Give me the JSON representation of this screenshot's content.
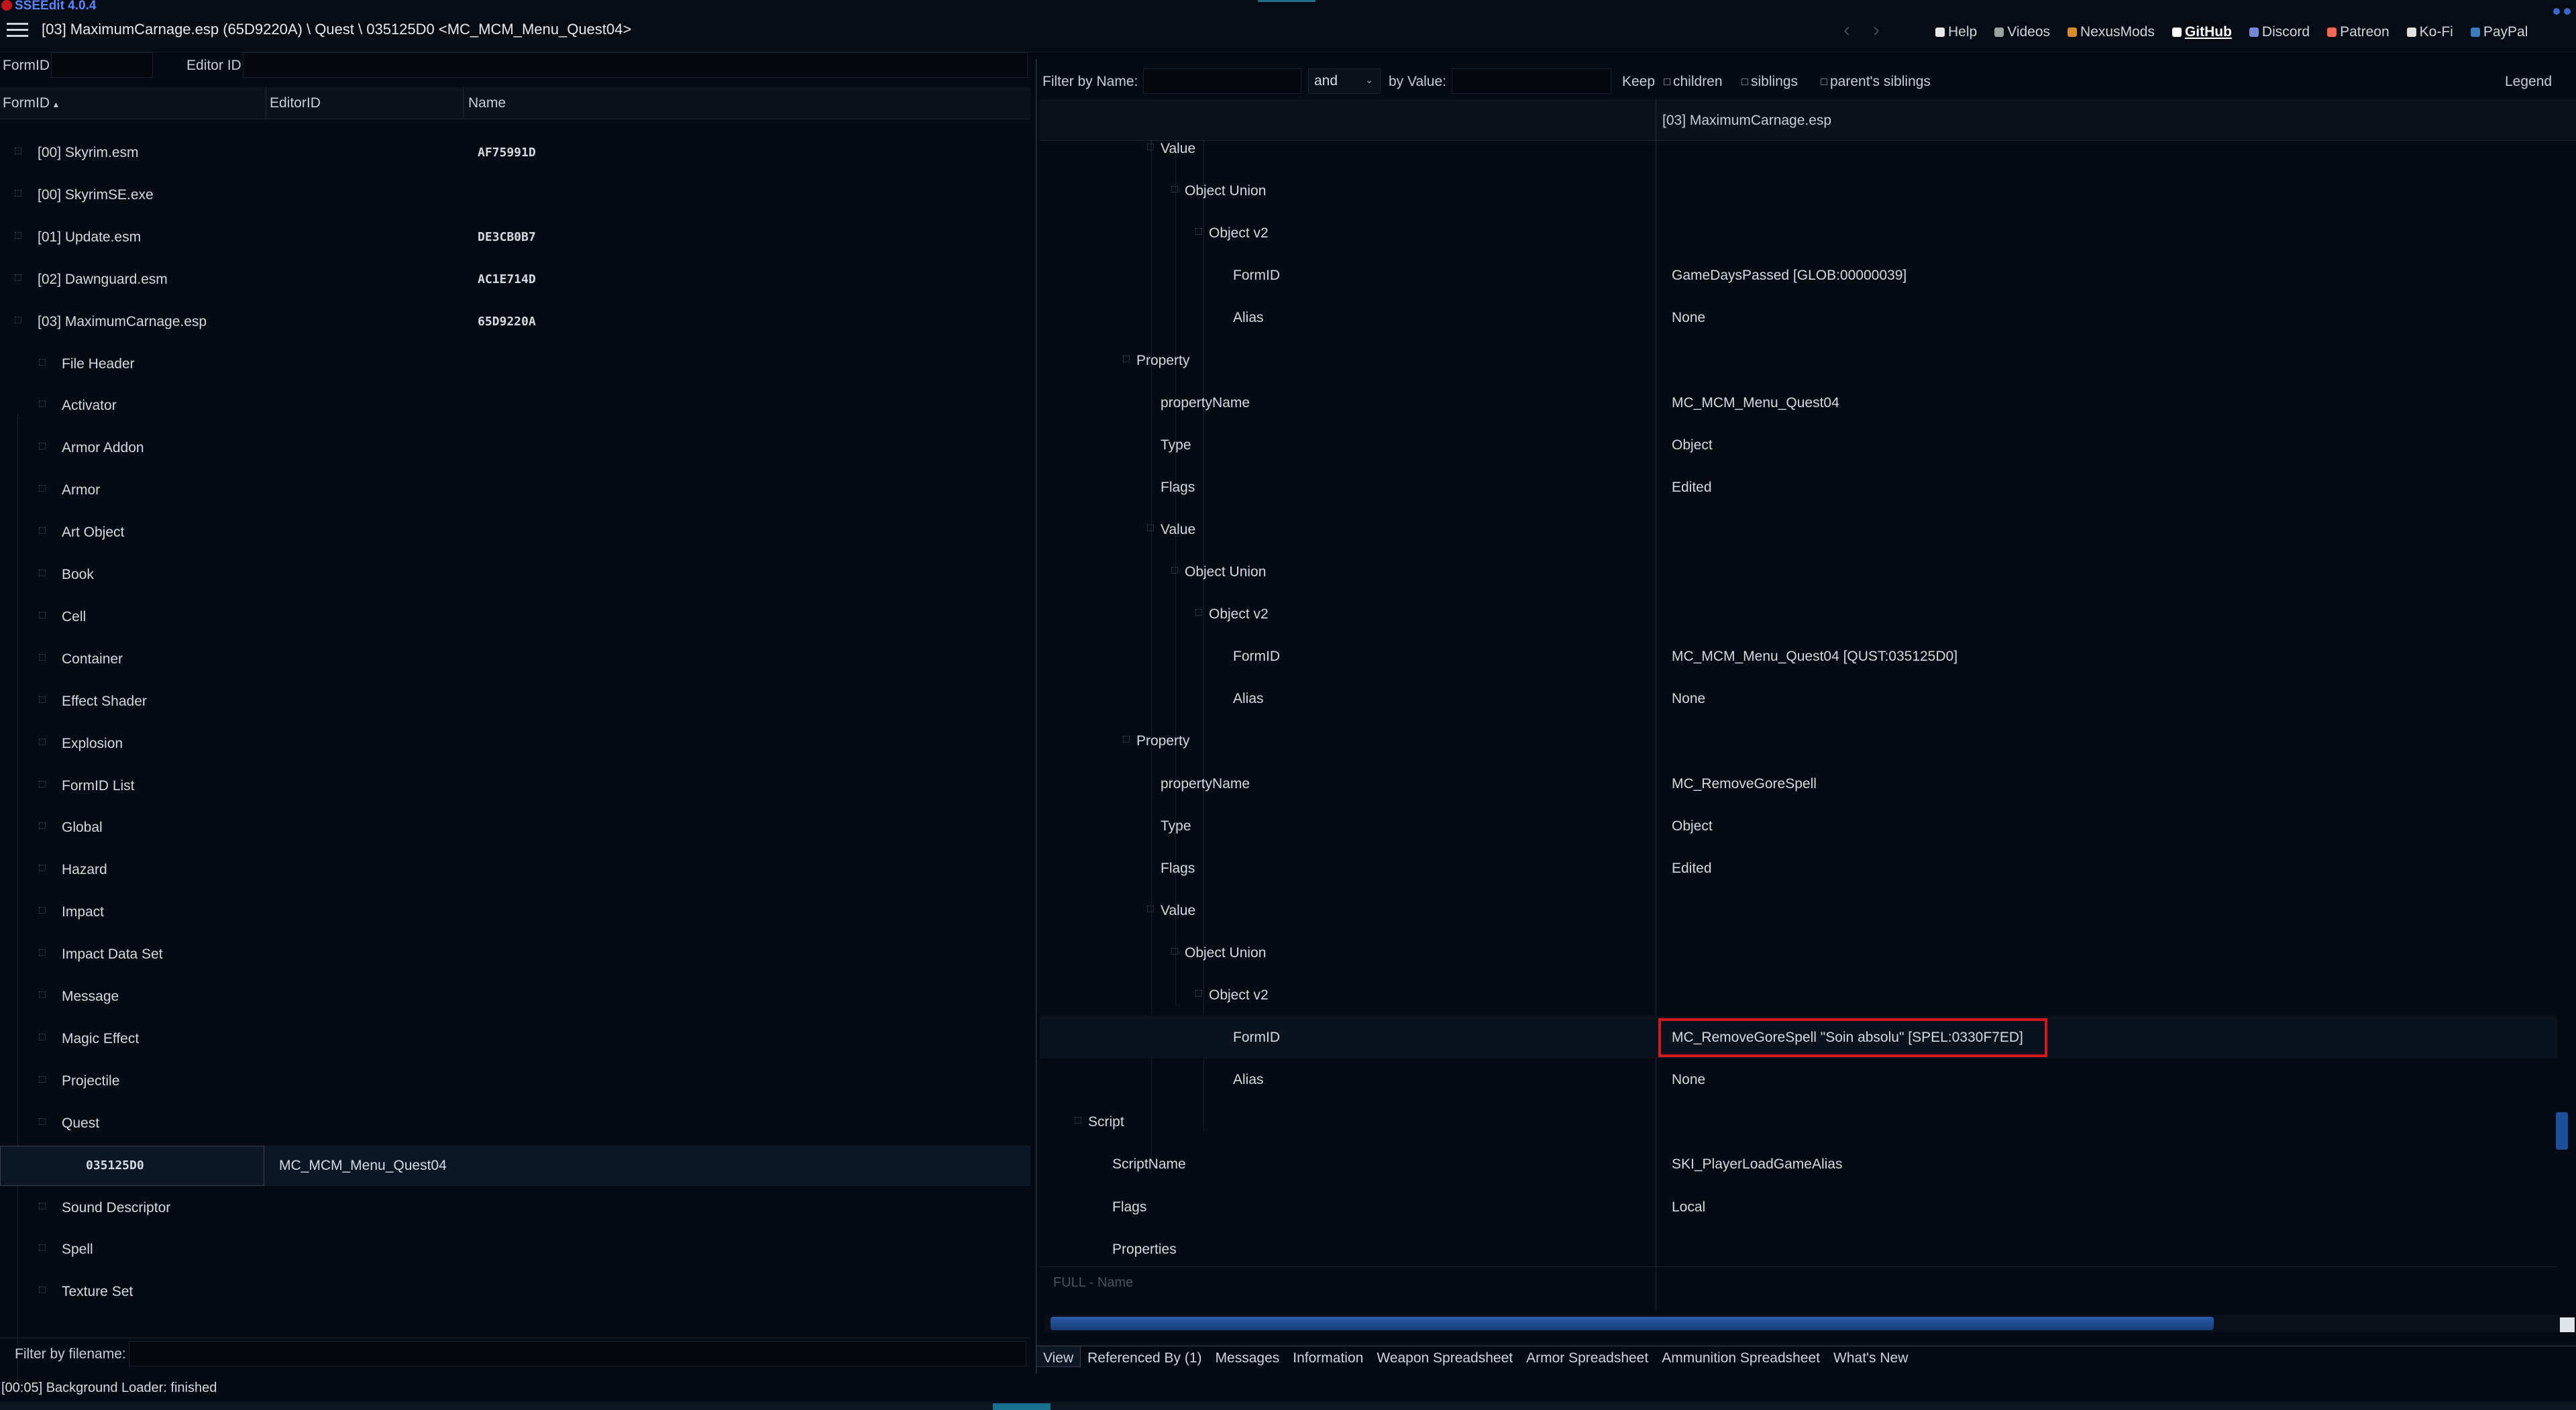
{
  "app": {
    "version": "SSEEdit 4.0.4",
    "path_title": "[03] MaximumCarnage.esp (65D9220A) \\ Quest \\ 035125D0 <MC_MCM_Menu_Quest04>"
  },
  "toolbar": {
    "back": "‹",
    "forward": "›",
    "links": [
      {
        "label": "Help",
        "icon": "book-icon",
        "color": "#e8e8e8"
      },
      {
        "label": "Videos",
        "icon": "video-icon",
        "color": "#9aa0a6"
      },
      {
        "label": "NexusMods",
        "icon": "nexus-icon",
        "color": "#d98c2a"
      },
      {
        "label": "GitHub",
        "icon": "github-icon",
        "color": "#ffffff"
      },
      {
        "label": "Discord",
        "icon": "discord-icon",
        "color": "#7289da"
      },
      {
        "label": "Patreon",
        "icon": "patreon-icon",
        "color": "#f96854"
      },
      {
        "label": "Ko-Fi",
        "icon": "kofi-icon",
        "color": "#e0e0e0"
      },
      {
        "label": "PayPal",
        "icon": "paypal-icon",
        "color": "#3b7bbf"
      }
    ]
  },
  "left": {
    "formid_label": "FormID",
    "editorid_label": "Editor ID",
    "columns": [
      "FormID",
      "EditorID",
      "Name"
    ],
    "sort_arrow": "▴",
    "tree": [
      {
        "label": "[00] Skyrim.esm",
        "hash": "AF75991D",
        "level": 0
      },
      {
        "label": "[00] SkyrimSE.exe",
        "hash": "",
        "level": 0
      },
      {
        "label": "[01] Update.esm",
        "hash": "DE3CB0B7",
        "level": 0
      },
      {
        "label": "[02] Dawnguard.esm",
        "hash": "AC1E714D",
        "level": 0
      },
      {
        "label": "[03] MaximumCarnage.esp",
        "hash": "65D9220A",
        "level": 0
      },
      {
        "label": "File Header",
        "hash": "",
        "level": 1
      },
      {
        "label": "Activator",
        "hash": "",
        "level": 1
      },
      {
        "label": "Armor Addon",
        "hash": "",
        "level": 1
      },
      {
        "label": "Armor",
        "hash": "",
        "level": 1
      },
      {
        "label": "Art Object",
        "hash": "",
        "level": 1
      },
      {
        "label": "Book",
        "hash": "",
        "level": 1
      },
      {
        "label": "Cell",
        "hash": "",
        "level": 1
      },
      {
        "label": "Container",
        "hash": "",
        "level": 1
      },
      {
        "label": "Effect Shader",
        "hash": "",
        "level": 1
      },
      {
        "label": "Explosion",
        "hash": "",
        "level": 1
      },
      {
        "label": "FormID List",
        "hash": "",
        "level": 1
      },
      {
        "label": "Global",
        "hash": "",
        "level": 1
      },
      {
        "label": "Hazard",
        "hash": "",
        "level": 1
      },
      {
        "label": "Impact",
        "hash": "",
        "level": 1
      },
      {
        "label": "Impact Data Set",
        "hash": "",
        "level": 1
      },
      {
        "label": "Message",
        "hash": "",
        "level": 1
      },
      {
        "label": "Magic Effect",
        "hash": "",
        "level": 1
      },
      {
        "label": "Projectile",
        "hash": "",
        "level": 1
      },
      {
        "label": "Quest",
        "hash": "",
        "level": 1
      }
    ],
    "selected": {
      "formid": "035125D0",
      "editorid": "MC_MCM_Menu_Quest04"
    },
    "tree_after": [
      "Sound Descriptor",
      "Spell",
      "Texture Set"
    ],
    "filter_label": "Filter by filename:"
  },
  "right": {
    "filter_name_label": "Filter by Name:",
    "and_value": "and",
    "by_value_label": "by Value:",
    "keep_label": "Keep",
    "keep_options": [
      "children",
      "siblings",
      "parent's siblings"
    ],
    "legend": "Legend",
    "column_title": "[03] MaximumCarnage.esp",
    "rows": [
      {
        "name": "Value",
        "value": "",
        "indent": 7,
        "exp": true
      },
      {
        "name": "Object Union",
        "value": "",
        "indent": 8,
        "exp": true
      },
      {
        "name": "Object v2",
        "value": "",
        "indent": 9,
        "exp": true
      },
      {
        "name": "FormID",
        "value": "GameDaysPassed [GLOB:00000039]",
        "indent": 10
      },
      {
        "name": "Alias",
        "value": "None",
        "indent": 10
      },
      {
        "name": "Property",
        "value": "",
        "indent": 6,
        "exp": true
      },
      {
        "name": "propertyName",
        "value": "MC_MCM_Menu_Quest04",
        "indent": 7
      },
      {
        "name": "Type",
        "value": "Object",
        "indent": 7
      },
      {
        "name": "Flags",
        "value": "Edited",
        "indent": 7
      },
      {
        "name": "Value",
        "value": "",
        "indent": 7,
        "exp": true
      },
      {
        "name": "Object Union",
        "value": "",
        "indent": 8,
        "exp": true
      },
      {
        "name": "Object v2",
        "value": "",
        "indent": 9,
        "exp": true
      },
      {
        "name": "FormID",
        "value": "MC_MCM_Menu_Quest04 [QUST:035125D0]",
        "indent": 10
      },
      {
        "name": "Alias",
        "value": "None",
        "indent": 10
      },
      {
        "name": "Property",
        "value": "",
        "indent": 6,
        "exp": true
      },
      {
        "name": "propertyName",
        "value": "MC_RemoveGoreSpell",
        "indent": 7
      },
      {
        "name": "Type",
        "value": "Object",
        "indent": 7
      },
      {
        "name": "Flags",
        "value": "Edited",
        "indent": 7
      },
      {
        "name": "Value",
        "value": "",
        "indent": 7,
        "exp": true
      },
      {
        "name": "Object Union",
        "value": "",
        "indent": 8,
        "exp": true
      },
      {
        "name": "Object v2",
        "value": "",
        "indent": 9,
        "exp": true
      },
      {
        "name": "FormID",
        "value": "MC_RemoveGoreSpell \"Soin absolu\" [SPEL:0330F7ED]",
        "indent": 10,
        "highlight": true
      },
      {
        "name": "Alias",
        "value": "None",
        "indent": 10
      },
      {
        "name": "Script",
        "value": "",
        "indent": 4,
        "exp": true
      },
      {
        "name": "ScriptName",
        "value": "SKI_PlayerLoadGameAlias",
        "indent": 5
      },
      {
        "name": "Flags",
        "value": "Local",
        "indent": 5
      },
      {
        "name": "Properties",
        "value": "",
        "indent": 5
      }
    ],
    "full_name_row": "FULL - Name",
    "tabs": [
      "View",
      "Referenced By (1)",
      "Messages",
      "Information",
      "Weapon Spreadsheet",
      "Armor Spreadsheet",
      "Ammunition Spreadsheet",
      "What's New"
    ]
  },
  "status": "[00:05] Background Loader: finished",
  "colors": {
    "highlight_border": "#d41b1b",
    "accent": "#1a6f8f",
    "selection": "#0b1726"
  }
}
